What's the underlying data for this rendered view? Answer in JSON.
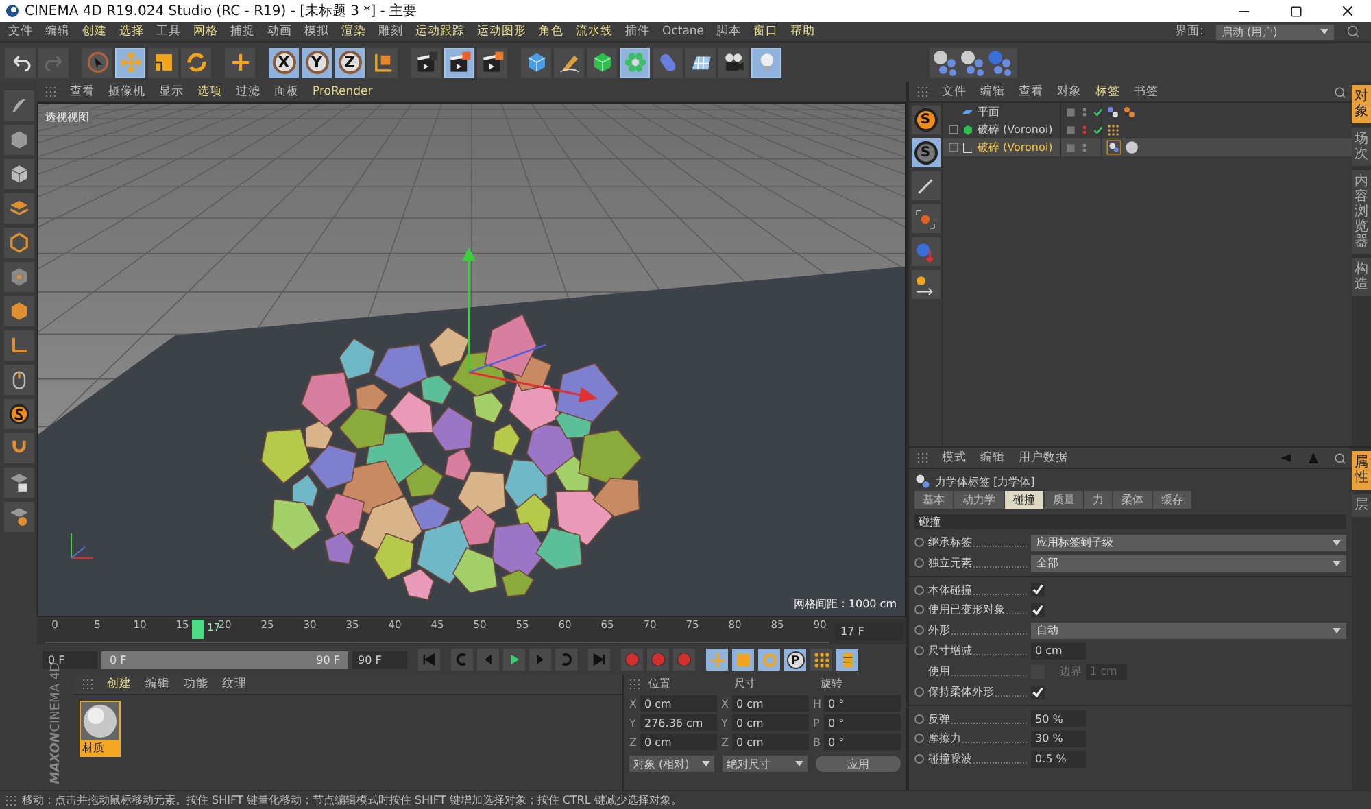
{
  "window": {
    "title": "CINEMA 4D R19.024 Studio (RC - R19) - [未标题 3 *] - 主要"
  },
  "menu": [
    {
      "label": "文件",
      "highlighted": false
    },
    {
      "label": "编辑",
      "highlighted": false
    },
    {
      "label": "创建",
      "highlighted": true
    },
    {
      "label": "选择",
      "highlighted": true
    },
    {
      "label": "工具",
      "highlighted": false
    },
    {
      "label": "网格",
      "highlighted": true
    },
    {
      "label": "捕捉",
      "highlighted": false
    },
    {
      "label": "动画",
      "highlighted": false
    },
    {
      "label": "模拟",
      "highlighted": false
    },
    {
      "label": "渲染",
      "highlighted": true
    },
    {
      "label": "雕刻",
      "highlighted": false
    },
    {
      "label": "运动跟踪",
      "highlighted": true
    },
    {
      "label": "运动图形",
      "highlighted": true
    },
    {
      "label": "角色",
      "highlighted": true
    },
    {
      "label": "流水线",
      "highlighted": true
    },
    {
      "label": "插件",
      "highlighted": false
    },
    {
      "label": "Octane",
      "highlighted": false
    },
    {
      "label": "脚本",
      "highlighted": false
    },
    {
      "label": "窗口",
      "highlighted": true
    },
    {
      "label": "帮助",
      "highlighted": true
    }
  ],
  "layout": {
    "label": "界面:",
    "value": "启动 (用户)"
  },
  "toolbar": {
    "tools_left": [
      {
        "selected": false
      },
      {
        "selected": false
      },
      {
        "selected": false
      },
      {
        "selected": true
      },
      {
        "selected": false
      },
      {
        "selected": false
      },
      {
        "selected": false
      }
    ],
    "axes": [
      {
        "label": "X",
        "selected": true
      },
      {
        "label": "Y",
        "selected": true
      },
      {
        "label": "Z",
        "selected": true
      }
    ],
    "tools_right": [
      {
        "selected": false
      },
      {
        "selected": false
      },
      {
        "selected": true
      },
      {
        "selected": false
      },
      {
        "selected": false
      },
      {
        "selected": false
      },
      {
        "selected": false
      },
      {
        "selected": true
      },
      {
        "selected": false
      },
      {
        "selected": false
      },
      {
        "selected": false
      },
      {
        "selected": true
      }
    ]
  },
  "viewport": {
    "menu": [
      {
        "label": "查看",
        "highlighted": false
      },
      {
        "label": "摄像机",
        "highlighted": false
      },
      {
        "label": "显示",
        "highlighted": false
      },
      {
        "label": "选项",
        "highlighted": true
      },
      {
        "label": "过滤",
        "highlighted": false
      },
      {
        "label": "面板",
        "highlighted": false
      },
      {
        "label": "ProRender",
        "highlighted": true
      }
    ],
    "view_name": "透视视图",
    "grid_spacing": "网格间距 : 1000 cm"
  },
  "timeline": {
    "ticks": [
      "0",
      "5",
      "10",
      "15",
      "20",
      "25",
      "30",
      "35",
      "40",
      "45",
      "50",
      "55",
      "60",
      "65",
      "70",
      "75",
      "80",
      "85",
      "90"
    ],
    "current": "17",
    "level": 0.189,
    "frame_field": "17 F"
  },
  "transport": {
    "start": "0 F",
    "range_start": "0 F",
    "range_end": "90 F",
    "level": 1,
    "end": "90 F",
    "keys": [
      {
        "selected": true
      },
      {
        "selected": true
      },
      {
        "selected": true
      },
      {
        "label": "P",
        "selected": true
      },
      {
        "selected": false
      },
      {
        "selected": true
      }
    ]
  },
  "materials": {
    "menu": [
      {
        "label": "创建",
        "highlighted": true
      },
      {
        "label": "编辑",
        "highlighted": false
      },
      {
        "label": "功能",
        "highlighted": false
      },
      {
        "label": "纹理",
        "highlighted": false
      }
    ],
    "items": [
      {
        "label": "材质",
        "selected": true
      }
    ],
    "logo": [
      "MAXON",
      "CINEMA 4D"
    ]
  },
  "coordinates": {
    "headers": [
      "位置",
      "尺寸",
      "旋转"
    ],
    "rows": [
      [
        {
          "axis": "X",
          "value": "0 cm"
        },
        {
          "axis": "X",
          "value": "0 cm"
        },
        {
          "axis": "H",
          "value": "0 °"
        }
      ],
      [
        {
          "axis": "Y",
          "value": "276.36 cm"
        },
        {
          "axis": "Y",
          "value": "0 cm"
        },
        {
          "axis": "P",
          "value": "0 °"
        }
      ],
      [
        {
          "axis": "Z",
          "value": "0 cm"
        },
        {
          "axis": "Z",
          "value": "0 cm"
        },
        {
          "axis": "B",
          "value": "0 °"
        }
      ]
    ],
    "mode": "对象 (相对)",
    "size_mode": "绝对尺寸",
    "apply": "应用"
  },
  "objects": {
    "menu": [
      {
        "label": "文件",
        "highlighted": false
      },
      {
        "label": "编辑",
        "highlighted": false
      },
      {
        "label": "查看",
        "highlighted": false
      },
      {
        "label": "对象",
        "highlighted": false
      },
      {
        "label": "标签",
        "highlighted": true
      },
      {
        "label": "书签",
        "highlighted": false
      }
    ],
    "side_tools": [
      {
        "label": "S",
        "selected": false
      },
      {
        "label": "S",
        "selected": true
      }
    ],
    "rows": [
      {
        "name": "平面",
        "expandable": false,
        "selected": false
      },
      {
        "name": "破碎 (Voronoi)",
        "expandable": true,
        "selected": false
      },
      {
        "name": "破碎 (Voronoi)",
        "expandable": true,
        "selected": true
      }
    ],
    "tabs": [
      {
        "label": "对象",
        "selected": true
      },
      {
        "label": "场次",
        "selected": false
      },
      {
        "label": "内容浏览器",
        "selected": false
      },
      {
        "label": "构造",
        "selected": false
      }
    ]
  },
  "attributes": {
    "menu": [
      {
        "label": "模式",
        "highlighted": false
      },
      {
        "label": "编辑",
        "highlighted": false
      },
      {
        "label": "用户数据",
        "highlighted": false
      }
    ],
    "title": "力学体标签 [力学体]",
    "tabs": [
      {
        "label": "基本",
        "selected": false
      },
      {
        "label": "动力学",
        "selected": false
      },
      {
        "label": "碰撞",
        "selected": true
      },
      {
        "label": "质量",
        "selected": false
      },
      {
        "label": "力",
        "selected": false
      },
      {
        "label": "柔体",
        "selected": false
      },
      {
        "label": "缓存",
        "selected": false
      }
    ],
    "section": "碰撞",
    "rows": [
      {
        "kind": "dropdown",
        "label": "继承标签",
        "value": "应用标签到子级"
      },
      {
        "kind": "dropdown",
        "label": "独立元素",
        "value": "全部"
      },
      {
        "kind": "check",
        "label": "本体碰撞",
        "checked": true
      },
      {
        "kind": "check",
        "label": "使用已变形对象",
        "checked": true
      },
      {
        "kind": "dropdown",
        "label": "外形",
        "value": "自动"
      },
      {
        "kind": "field",
        "label": "尺寸增减",
        "value": "0 cm"
      },
      {
        "kind": "border",
        "label": "使用",
        "checked": false,
        "sub_label": "边界",
        "value": "1 cm"
      },
      {
        "kind": "check",
        "label": "保持柔体外形",
        "checked": true
      },
      {
        "kind": "field",
        "label": "反弹",
        "value": "50 %"
      },
      {
        "kind": "field",
        "label": "摩擦力",
        "value": "30 %"
      },
      {
        "kind": "field",
        "label": "碰撞噪波",
        "value": "0.5 %"
      }
    ],
    "tabs_side": [
      {
        "label": "属性",
        "selected": true
      },
      {
        "label": "层",
        "selected": false
      }
    ]
  },
  "status_bar": "移动：点击并拖动鼠标移动元素。按住 SHIFT 键量化移动；节点编辑模式时按住 SHIFT 键增加选择对象；按住 CTRL 键减少选择对象。"
}
